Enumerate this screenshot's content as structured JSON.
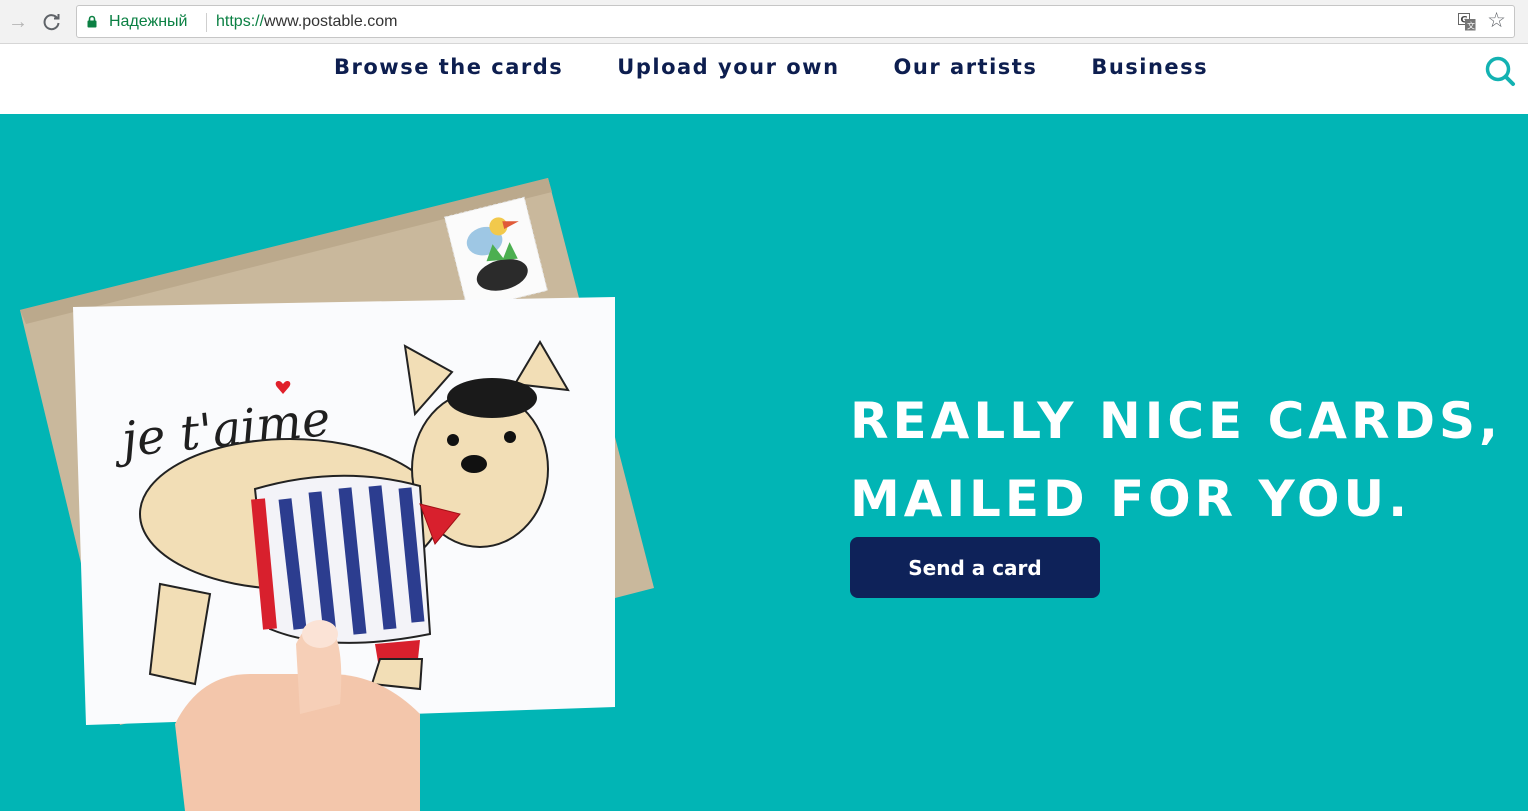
{
  "browser": {
    "security_label": "Надежный",
    "url_scheme": "https://",
    "url_host": "www.postable.com",
    "icons": [
      "arrow-forward-icon",
      "reload-icon",
      "lock-icon",
      "translate-icon",
      "star-icon"
    ]
  },
  "nav": {
    "items": [
      {
        "label": "Browse the cards"
      },
      {
        "label": "Upload your own"
      },
      {
        "label": "Our artists"
      },
      {
        "label": "Business"
      }
    ],
    "search_icon": "search-icon"
  },
  "hero": {
    "headline_line1": "REALLY NICE CARDS,",
    "headline_line2": "MAILED FOR YOU.",
    "cta_label": "Send a card",
    "card_text": "je t'aime"
  },
  "colors": {
    "hero_background": "#01b5b5",
    "nav_text": "#0d1e4f",
    "cta_background": "#0e2259",
    "search_accent": "#13b2b2",
    "secure_green": "#0b8043"
  }
}
